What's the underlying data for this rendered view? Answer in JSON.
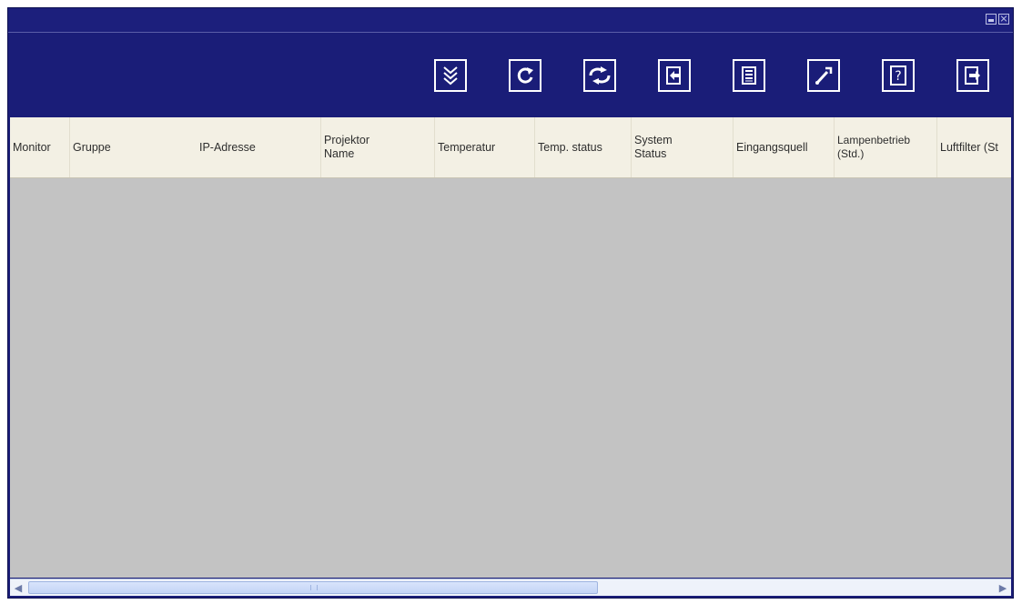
{
  "window": {
    "controls": [
      "minimize-icon",
      "close-icon"
    ]
  },
  "toolbar": {
    "buttons": [
      {
        "icon": "expand-down-icon"
      },
      {
        "icon": "refresh-icon"
      },
      {
        "icon": "reconnect-icon"
      },
      {
        "icon": "login-icon"
      },
      {
        "icon": "list-view-icon"
      },
      {
        "icon": "wrench-icon"
      },
      {
        "icon": "help-icon",
        "symbol": "?"
      },
      {
        "icon": "exit-icon"
      }
    ]
  },
  "table": {
    "columns": [
      {
        "label": "Monitor"
      },
      {
        "label": "Gruppe"
      },
      {
        "label": "IP-Adresse"
      },
      {
        "label": "Projektor\nName"
      },
      {
        "label": "Temperatur"
      },
      {
        "label": "Temp. status"
      },
      {
        "label": "System\nStatus"
      },
      {
        "label": "Eingangsquell"
      },
      {
        "label": "Lampenbetrieb\n(Std.)"
      },
      {
        "label": "Luftfilter (St"
      }
    ],
    "rows": []
  },
  "colors": {
    "window_bg": "#1a1d78",
    "header_bg": "#f3f0e4",
    "grid_bg": "#c3c3c3",
    "scroll_bg": "#eef2fa"
  }
}
